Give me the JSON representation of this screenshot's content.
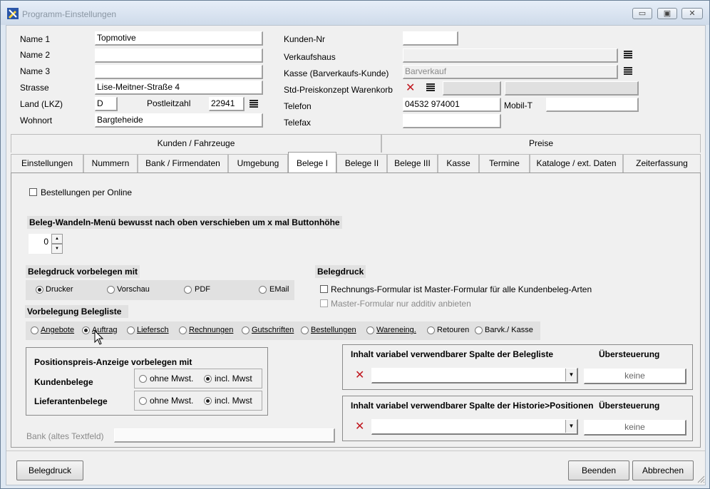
{
  "window": {
    "title": "Programm-Einstellungen",
    "minimize_glyph": "▭",
    "maximize_glyph": "▣",
    "close_glyph": "✕"
  },
  "form": {
    "name1_label": "Name 1",
    "name1_value": "Topmotive",
    "name2_label": "Name 2",
    "name2_value": "",
    "name3_label": "Name 3",
    "name3_value": "",
    "strasse_label": "Strasse",
    "strasse_value": "Lise-Meitner-Straße 4",
    "land_label": "Land (LKZ)",
    "land_value": "D",
    "plz_label": "Postleitzahl",
    "plz_value": "22941",
    "wohnort_label": "Wohnort",
    "wohnort_value": "Bargteheide",
    "kundennr_label": "Kunden-Nr",
    "kundennr_value": "",
    "verkaufshaus_label": "Verkaufshaus",
    "verkaufshaus_value": "",
    "kasse_label": "Kasse (Barverkaufs-Kunde)",
    "kasse_value": "Barverkauf",
    "preiskonzept_label": "Std-Preiskonzept Warenkorb",
    "telefon_label": "Telefon",
    "telefon_value": "04532 974001",
    "mobil_label": "Mobil-T",
    "mobil_value": "",
    "telefax_label": "Telefax",
    "telefax_value": ""
  },
  "tab_groups": [
    "Kunden / Fahrzeuge",
    "Preise"
  ],
  "tabs": [
    "Einstellungen",
    "Nummern",
    "Bank / Firmendaten",
    "Umgebung",
    "Belege I",
    "Belege II",
    "Belege III",
    "Kasse",
    "Termine",
    "Kataloge / ext. Daten",
    "Zeiterfassung"
  ],
  "active_tab": "Belege I",
  "panel": {
    "online_label": "Bestellungen per Online",
    "online_checked": false,
    "wandeln_header": "Beleg-Wandeln-Menü bewusst nach oben verschieben um x mal Buttonhöhe",
    "wandeln_value": "0",
    "spin_up": "▲",
    "spin_down": "▼",
    "belegdruck_default_header": "Belegdruck vorbelegen mit",
    "print_options": [
      "Drucker",
      "Vorschau",
      "PDF",
      "EMail"
    ],
    "print_selected": "Drucker",
    "belegdruck_header": "Belegdruck",
    "master_formular_label": "Rechnungs-Formular ist Master-Formular für alle Kundenbeleg-Arten",
    "master_formular_checked": false,
    "master_additiv_label": "Master-Formular nur additiv anbieten",
    "master_additiv_checked": false,
    "belegliste_header": "Vorbelegung Belegliste",
    "belegliste_options": [
      "Angebote",
      "Auftrag",
      "Liefersch",
      "Rechnungen",
      "Gutschriften",
      "Bestellungen",
      "Wareneing.",
      "Retouren",
      "Barvk./ Kasse"
    ],
    "belegliste_selected": "Auftrag",
    "positionspreis_header": "Positionspreis-Anzeige vorbelegen mit",
    "kundenbelege_label": "Kundenbelege",
    "lieferantenbelege_label": "Lieferantenbelege",
    "mwst_options": [
      "ohne Mwst.",
      "incl. Mwst"
    ],
    "kundenbelege_selected": "incl. Mwst",
    "lieferantenbelege_selected": "incl. Mwst",
    "spalte_belegliste_header": "Inhalt variabel verwendbarer Spalte der Belegliste",
    "spalte_historie_header": "Inhalt variabel verwendbarer Spalte der Historie>Positionen",
    "uebersteuerung_label": "Übersteuerung",
    "keine_label": "keine",
    "bank_label": "Bank (altes Textfeld)",
    "bank_value": ""
  },
  "footer": {
    "belegdruck_button": "Belegdruck",
    "beenden_button": "Beenden",
    "abbrechen_button": "Abbrechen"
  },
  "icons": {
    "delete": "✕",
    "dropdown": "▼"
  },
  "colors": {
    "delete_red": "#c0171f",
    "titlebar": "#dfe8f2"
  }
}
